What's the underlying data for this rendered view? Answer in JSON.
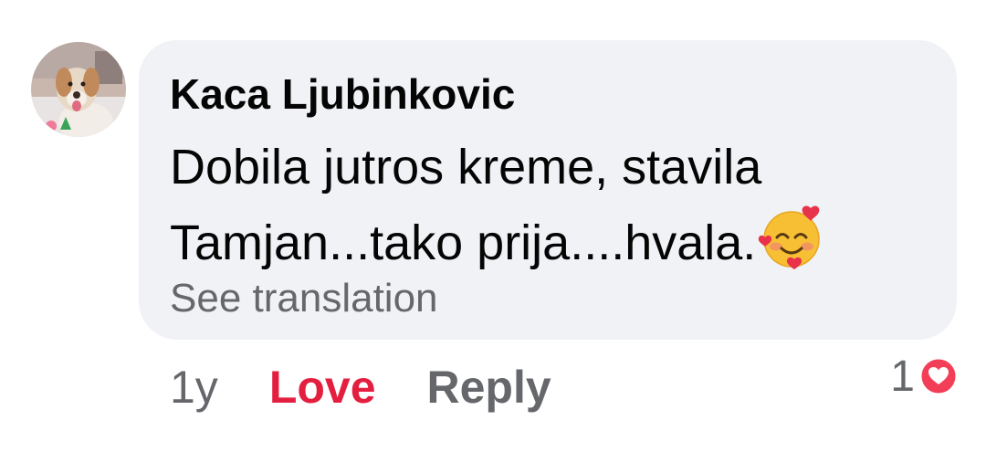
{
  "comment": {
    "author": "Kaca Ljubinkovic",
    "text_lines": [
      "Dobila jutros kreme, stavila",
      "Tamjan...tako prija....hvala."
    ],
    "emoji": "smiling-face-with-hearts",
    "see_translation": "See translation"
  },
  "actions": {
    "time": "1y",
    "love_label": "Love",
    "reply_label": "Reply"
  },
  "reactions": {
    "count": "1",
    "type": "love",
    "icon": "heart-icon"
  },
  "colors": {
    "bubble": "#f0f2f5",
    "love": "#e41e3f",
    "secondary_text": "#65676b",
    "primary_text": "#050505"
  }
}
